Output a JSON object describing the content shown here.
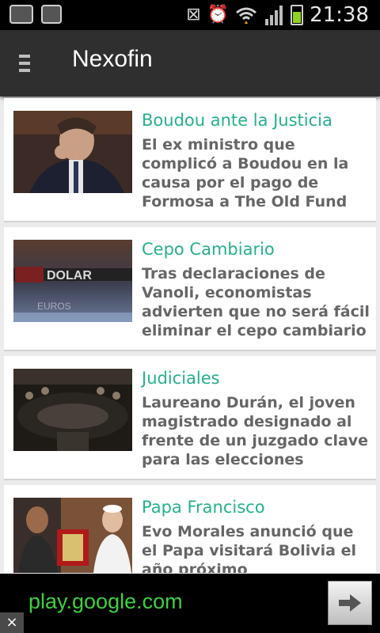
{
  "status_bar": {
    "time": "21:38",
    "icons": [
      "voicemail-icon",
      "briefcase-icon",
      "vibrate-icon",
      "alarm-icon",
      "wifi-icon",
      "signal-icon",
      "battery-icon"
    ]
  },
  "action_bar": {
    "title": "Nexofin",
    "menu_icon": "menu-icon"
  },
  "articles": [
    {
      "category": "Boudou ante la Justicia",
      "headline": "El ex ministro que complicó a Boudou en la causa por el pago de Formosa a The Old Fund"
    },
    {
      "category": "Cepo Cambiario",
      "headline": "Tras declaraciones de Vanoli, economistas advierten que no será fácil eliminar el cepo cambiario"
    },
    {
      "category": "Judiciales",
      "headline": "Laureano Durán, el joven magistrado designado al frente de un juzgado clave para las elecciones"
    },
    {
      "category": "Papa Francisco",
      "headline": "Evo Morales anunció que el Papa visitará Bolivia el año próximo"
    }
  ],
  "ad": {
    "url": "play.google.com",
    "close_label": "×",
    "go_icon": "arrow-right-icon"
  },
  "colors": {
    "accent": "#25b08f",
    "action_bar": "#2f2f2f",
    "ad_text": "#3dd13d"
  }
}
